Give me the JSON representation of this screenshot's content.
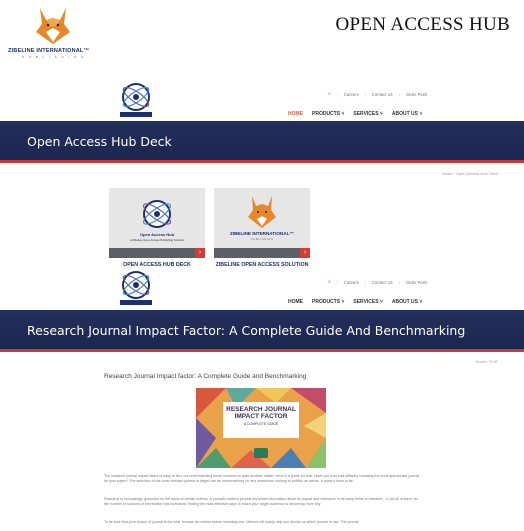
{
  "banner": {
    "title": "OPEN ACCESS HUB",
    "brand_name": "ZIBELINE INTERNATIONAL™",
    "brand_sub": "P U B L I S H I N G"
  },
  "nav1": {
    "topbar": [
      "Careers",
      "Contact Us",
      "Order Parts"
    ],
    "menu": [
      "HOME",
      "PRODUCTS ˅",
      "SERVICES ˅",
      "ABOUT US ˅"
    ],
    "hero_title": "Open Access Hub Deck",
    "breadcrumb": "Home / Open Access Hub Deck"
  },
  "cards": [
    {
      "label": "OPEN ACCESS HUB DECK",
      "logo_text": "Open Access Hub",
      "logo_sub": "A Zibeline Open Access Publishing Solution"
    },
    {
      "label": "ZIBELINE OPEN ACCESS SOLUTION",
      "logo_text": "ZIBELINE INTERNATIONAL™",
      "logo_sub": "P U B L I S H I N G"
    }
  ],
  "nav2": {
    "topbar": [
      "Careers",
      "Contact Us",
      "Order Parts"
    ],
    "menu": [
      "HOME",
      "PRODUCTS ˅",
      "SERVICES ˅",
      "ABOUT US ˅"
    ],
    "hero_title": "Research Journal Impact Factor: A Complete Guide And Benchmarking",
    "breadcrumb": "Home / RJIF"
  },
  "article": {
    "title": "Research Journal Impact factor: A Complete Guide and Benchmarking",
    "cover_title": "RESEARCH JOURNAL IMPACT FACTOR",
    "cover_sub": "A COMPLETE GUIDE",
    "paragraphs": [
      "The research journal impact factor is easy to find, but understanding these numbers is quite another matter. Here is a guide for that. Have you ever had difficulty choosing the most appropriate journal for your paper? The selection of the most relevant journal to target can be overwhelming for any researcher looking to publish an article. It doesn't have to be.",
      "Research is increasingly grounded on the basis of certain metrics. A journal's metrics provide important information about its impact and relevance in its many fields of research – if not all of them. As the number of sources of information has increased, finding the most effective ways to reach your target audience is becoming more key.",
      "To be sure that your choice of journal is the best, browse its metrics before selecting one. Metrics will surely help you decide on which journal to use. The journal"
    ]
  },
  "colors": {
    "navy": "#1d2f6e",
    "accent_red": "#c33b3b",
    "orange": "#e8872a"
  }
}
